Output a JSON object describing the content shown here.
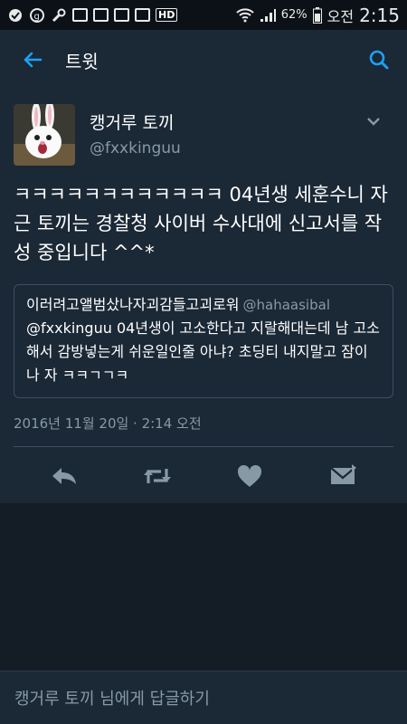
{
  "statusbar": {
    "battery_percent": "62%",
    "ampm": "오전",
    "time": "2:15",
    "icons": [
      "notification-icon",
      "g-icon",
      "wrench-icon",
      "app-icon",
      "image-icon",
      "app-icon",
      "app-icon",
      "hd-icon",
      "wifi-icon",
      "signal-icon",
      "battery-icon"
    ]
  },
  "appbar": {
    "title": "트윗",
    "back_icon": "arrow-left-icon",
    "search_icon": "search-icon"
  },
  "tweet": {
    "author_name": "캥거루 토끼",
    "author_handle": "@fxxkinguu",
    "text": "ㅋㅋㅋㅋㅋㅋㅋㅋㅋㅋㅋㅋ 04년생 세훈수니 자근 토끼는 경찰청 사이버 수사대에 신고서를 작성 중입니다 ^^*",
    "quoted": {
      "user_name": "이러려고앨범샀나자괴감들고괴로워",
      "user_handle": "@hahaasibal",
      "text": "@fxxkinguu 04년생이 고소한다고 지랄해대는데 남 고소해서 감방넣는게 쉬운일인줄 아냐? 초딩티 내지말고 잠이나 자 ㅋㅋㄱㄱㅋ"
    },
    "timestamp": "2016년 11월 20일 · 2:14 오전",
    "actions": [
      "reply-icon",
      "retweet-icon",
      "like-icon",
      "dm-icon"
    ]
  },
  "reply_bar": {
    "placeholder": "캥거루 토끼 님에게 답글하기"
  },
  "colors": {
    "background": "#141d26",
    "card": "#1b2836",
    "accent": "#1da1f2",
    "secondary_text": "#8899a6",
    "divider": "#3d4f61"
  }
}
